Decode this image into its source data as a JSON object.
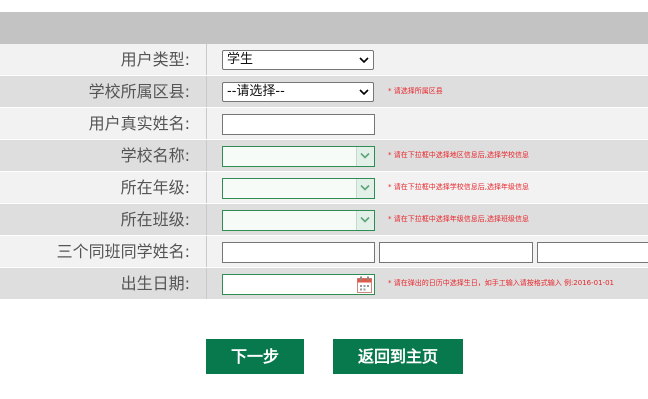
{
  "form": {
    "user_type": {
      "label": "用户类型:",
      "value": "学生"
    },
    "school_district": {
      "label": "学校所属区县:",
      "value": "--请选择--",
      "hint": "* 请选择所属区县"
    },
    "real_name": {
      "label": "用户真实姓名:",
      "value": ""
    },
    "school_name": {
      "label": "学校名称:",
      "value": "",
      "hint": "* 请在下拉框中选择地区信息后,选择学校信息"
    },
    "grade": {
      "label": "所在年级:",
      "value": "",
      "hint": "* 请在下拉框中选择学校信息后,选择年级信息"
    },
    "class": {
      "label": "所在班级:",
      "value": "",
      "hint": "* 请在下拉框中选择年级信息后,选择班级信息"
    },
    "classmates": {
      "label": "三个同班同学姓名:",
      "values": [
        "",
        "",
        ""
      ]
    },
    "birth_date": {
      "label": "出生日期:",
      "value": "",
      "hint": "* 请在弹出的日历中选择生日，如手工输入请按格式输入 例:2016-01-01"
    }
  },
  "actions": {
    "next_label": "下一步",
    "home_label": "返回到主页"
  },
  "colors": {
    "accent_green": "#07794c",
    "hint_red": "#e8262b",
    "header_gray": "#c3c3c3"
  },
  "icons": {
    "dropdown": "chevron-down-icon",
    "calendar": "calendar-icon"
  }
}
